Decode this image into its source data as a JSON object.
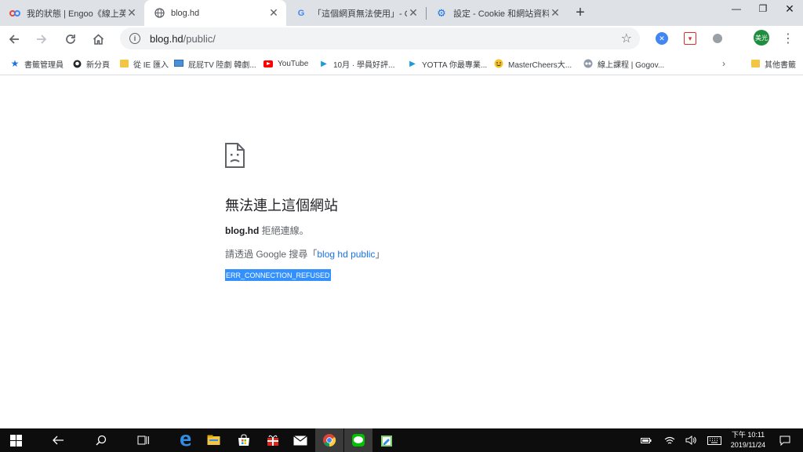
{
  "tabs": [
    {
      "title": "我的狀態 | Engoo《線上英文家",
      "icon": "engoo-icon"
    },
    {
      "title": "blog.hd",
      "icon": "globe-icon"
    },
    {
      "title": "「這個網頁無法使用」- Chrom",
      "icon": "google-icon"
    },
    {
      "title": "設定 - Cookie 和網站資料",
      "icon": "settings-gear-icon"
    }
  ],
  "toolbar": {
    "url_host": "blog.hd",
    "url_path": "/public/",
    "avatar_text": "美光"
  },
  "bookmarks": [
    {
      "label": "書籤管理員",
      "icon": "star-icon"
    },
    {
      "label": "新分頁",
      "icon": "github-icon"
    },
    {
      "label": "從 IE 匯入",
      "icon": "folder-icon"
    },
    {
      "label": "屁屁TV 陸劇 韓劇...",
      "icon": "tv-icon"
    },
    {
      "label": "YouTube",
      "icon": "youtube-icon"
    },
    {
      "label": "10月 · 學員好評...",
      "icon": "play-icon"
    },
    {
      "label": "YOTTA 你最專業...",
      "icon": "play-icon"
    },
    {
      "label": "MasterCheers大...",
      "icon": "smiley-icon"
    },
    {
      "label": "線上課程 | Gogov...",
      "icon": "owl-icon"
    }
  ],
  "other_bookmarks": "其他書籤",
  "error": {
    "title": "無法連上這個網站",
    "host": "blog.hd",
    "refused_text": " 拒絕連線。",
    "search_prefix": "請透過 Google 搜尋「",
    "search_link": "blog hd public",
    "search_suffix": "」",
    "code": "ERR_CONNECTION_REFUSED"
  },
  "taskbar": {
    "time": "下午 10:11",
    "date": "2019/11/24"
  },
  "colors": {
    "tabstrip_bg": "#dee1e6",
    "link": "#1a73e8",
    "selection": "#3390ff",
    "taskbar_bg": "#0d0d0d"
  }
}
